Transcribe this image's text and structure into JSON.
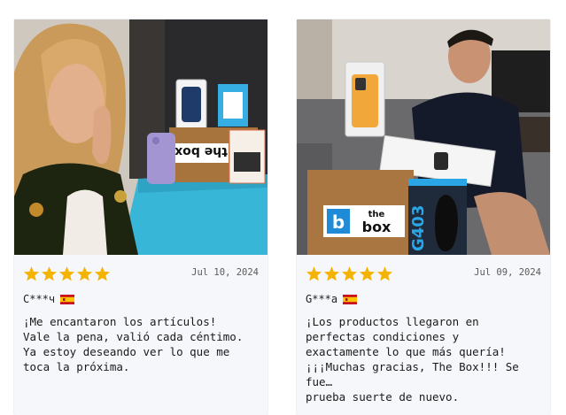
{
  "reviews": [
    {
      "rating": 5,
      "date": "Jul 10, 2024",
      "author": "C***ч",
      "country_flag": "spain-flag",
      "text": "¡Me encantaron los artículos!\nVale la pena, valió cada céntimo.\nYa estoy deseando ver lo que me\ntoca la próxima.",
      "photo_text": {
        "box_logo": "the box"
      }
    },
    {
      "rating": 5,
      "date": "Jul 09, 2024",
      "author": "G***a",
      "country_flag": "spain-flag",
      "text": "¡Los productos llegaron en\nperfectas condiciones y\nexactamente lo que más quería!\n¡¡¡Muchas gracias, The Box!!! Se\nfue…\nprueba suerte de nuevo.",
      "photo_text": {
        "box_logo_the": "the",
        "box_logo_box": "box",
        "mouse_box": "G403"
      }
    }
  ],
  "colors": {
    "star": "#f5b301",
    "card_bg": "#f5f7fa",
    "text": "#1a1a1a",
    "date": "#5a5a5a"
  }
}
